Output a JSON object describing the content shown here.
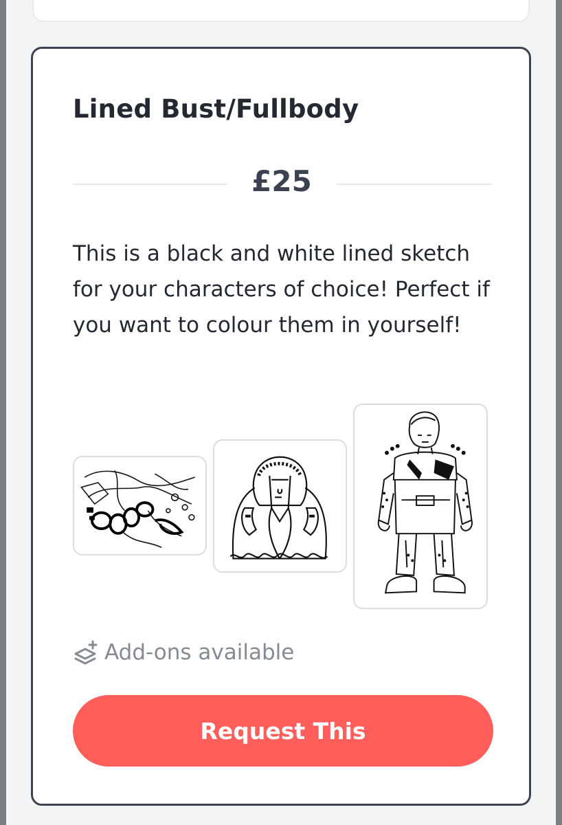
{
  "listing": {
    "title": "Lined Bust/Fullbody",
    "price": "£25",
    "description": "This is a black and white lined sketch for your characters of choice! Perfect if you want to colour them in yourself!",
    "addons_label": "Add-ons available",
    "request_button_label": "Request This",
    "addons_icon": "layers-plus-icon",
    "sample_images": [
      {
        "name": "sample-sketch-dragon"
      },
      {
        "name": "sample-sketch-coat-figure"
      },
      {
        "name": "sample-sketch-armored-character"
      }
    ]
  },
  "colors": {
    "button": "#ff5e5b",
    "card_border": "#3d4350",
    "title_text": "#232831",
    "muted_text": "#868a91"
  }
}
